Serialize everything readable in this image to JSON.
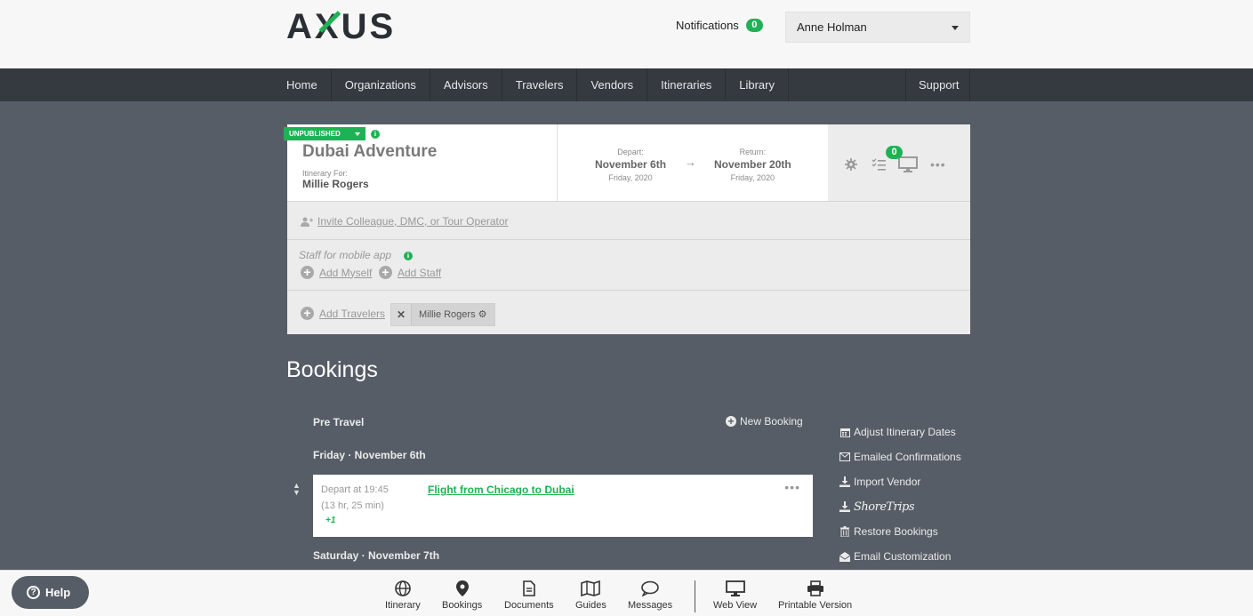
{
  "header": {
    "logo": "AXUS",
    "notifications_label": "Notifications",
    "notifications_count": "0",
    "user": "Anne Holman"
  },
  "nav": {
    "items": [
      "Home",
      "Organizations",
      "Advisors",
      "Travelers",
      "Vendors",
      "Itineraries",
      "Library"
    ],
    "support": "Support"
  },
  "itinerary": {
    "status": "UNPUBLISHED",
    "title": "Dubai Adventure",
    "for_label": "Itinerary For:",
    "for_name": "Millie Rogers",
    "depart_label": "Depart:",
    "depart_date": "November 6th",
    "depart_day": "Friday, 2020",
    "return_label": "Return:",
    "return_date": "November 20th",
    "return_day": "Friday, 2020",
    "checklist_count": "0",
    "invite_link": "Invite Colleague, DMC, or Tour Operator",
    "staff_title": "Staff for mobile app",
    "add_myself": "Add Myself",
    "add_staff": "Add Staff",
    "add_travelers": "Add Travelers",
    "traveler_name": "Millie Rogers"
  },
  "bookings": {
    "title": "Bookings",
    "pre_travel": "Pre Travel",
    "new_booking": "New Booking",
    "day1": "Friday · November 6th",
    "day2": "Saturday · November 7th",
    "flight": {
      "time": "Depart at 19:45",
      "duration": "(13 hr, 25 min)",
      "plus": "+1",
      "title": "Flight from Chicago to Dubai"
    }
  },
  "side_actions": {
    "adjust": "Adjust Itinerary Dates",
    "emailed": "Emailed Confirmations",
    "import": "Import Vendor",
    "shoretrips": "ShoreTrips",
    "restore": "Restore Bookings",
    "email_custom": "Email Customization"
  },
  "bottom": {
    "help": "Help",
    "itinerary": "Itinerary",
    "bookings": "Bookings",
    "documents": "Documents",
    "guides": "Guides",
    "messages": "Messages",
    "web_view": "Web View",
    "printable": "Printable Version"
  },
  "colors": {
    "accent": "#1fb254",
    "nav_bg": "#343a40",
    "page_bg": "#575d66"
  }
}
